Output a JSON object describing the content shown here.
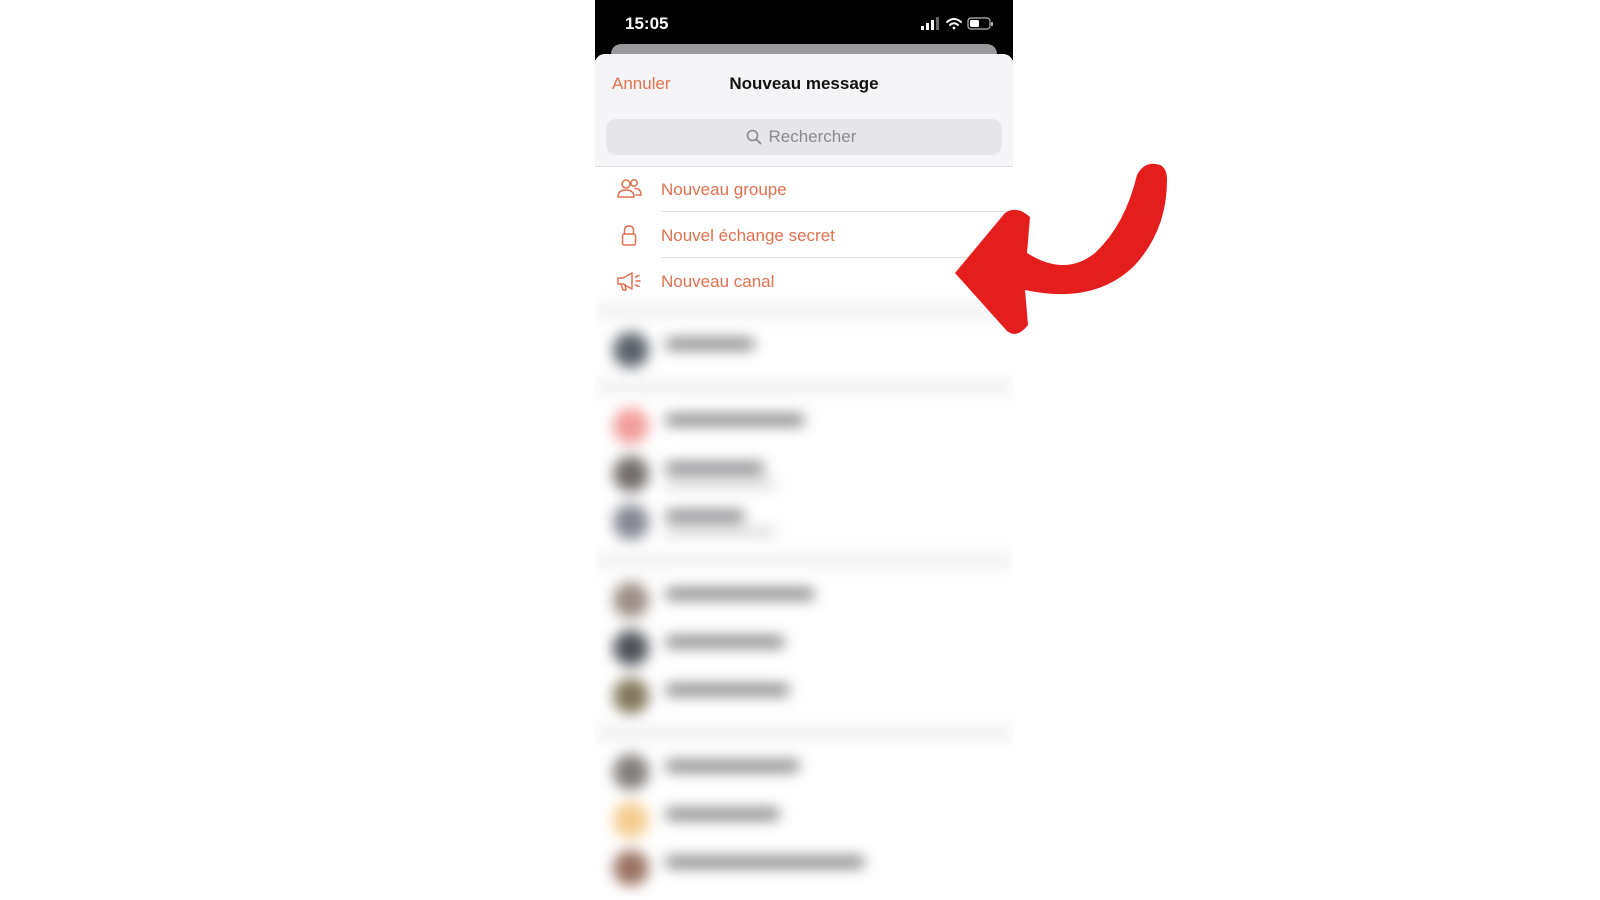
{
  "status_bar": {
    "time": "15:05"
  },
  "sheet": {
    "cancel_label": "Annuler",
    "title": "Nouveau message",
    "search_placeholder": "Rechercher"
  },
  "menu": {
    "items": [
      {
        "label": "Nouveau groupe",
        "icon": "group-icon"
      },
      {
        "label": "Nouvel échange secret",
        "icon": "lock-icon"
      },
      {
        "label": "Nouveau canal",
        "icon": "megaphone-icon"
      }
    ]
  },
  "colors": {
    "accent": "#e0714f",
    "arrow": "#e51d1d",
    "status_bar_bg": "#000000"
  }
}
